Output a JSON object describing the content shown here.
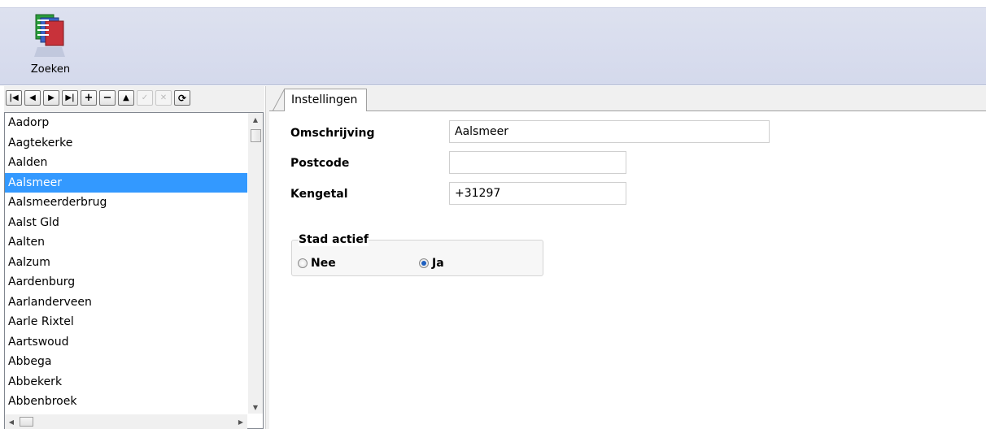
{
  "ribbon": {
    "search_button_label": "Zoeken"
  },
  "navigator": {
    "buttons": [
      {
        "name": "first-record-button",
        "glyph": "|◀",
        "enabled": true
      },
      {
        "name": "prior-record-button",
        "glyph": "◀",
        "enabled": true
      },
      {
        "name": "next-record-button",
        "glyph": "▶",
        "enabled": true
      },
      {
        "name": "last-record-button",
        "glyph": "▶|",
        "enabled": true
      },
      {
        "name": "insert-record-button",
        "glyph": "+",
        "enabled": true
      },
      {
        "name": "delete-record-button",
        "glyph": "−",
        "enabled": true
      },
      {
        "name": "edit-record-button",
        "glyph": "▲",
        "enabled": true
      },
      {
        "name": "post-record-button",
        "glyph": "✓",
        "enabled": false
      },
      {
        "name": "cancel-record-button",
        "glyph": "✕",
        "enabled": false
      },
      {
        "name": "refresh-button",
        "glyph": "⟳",
        "enabled": true
      }
    ]
  },
  "list": {
    "items": [
      "Aadorp",
      "Aagtekerke",
      "Aalden",
      "Aalsmeer",
      "Aalsmeerderbrug",
      "Aalst Gld",
      "Aalten",
      "Aalzum",
      "Aardenburg",
      "Aarlanderveen",
      "Aarle Rixtel",
      "Aartswoud",
      "Abbega",
      "Abbekerk",
      "Abbenbroek"
    ],
    "selected_index": 3
  },
  "tabs": [
    {
      "label": "Instellingen",
      "active": true
    }
  ],
  "form": {
    "omschrijving_label": "Omschrijving",
    "omschrijving_value": "Aalsmeer",
    "postcode_label": "Postcode",
    "postcode_value": "",
    "kengetal_label": "Kengetal",
    "kengetal_value": "+31297",
    "group_title": "Stad actief",
    "radio_nee_label": "Nee",
    "radio_ja_label": "Ja",
    "stad_actief": "Ja"
  },
  "colors": {
    "selection": "#3399ff",
    "ribbon": "#d4d9ec"
  }
}
